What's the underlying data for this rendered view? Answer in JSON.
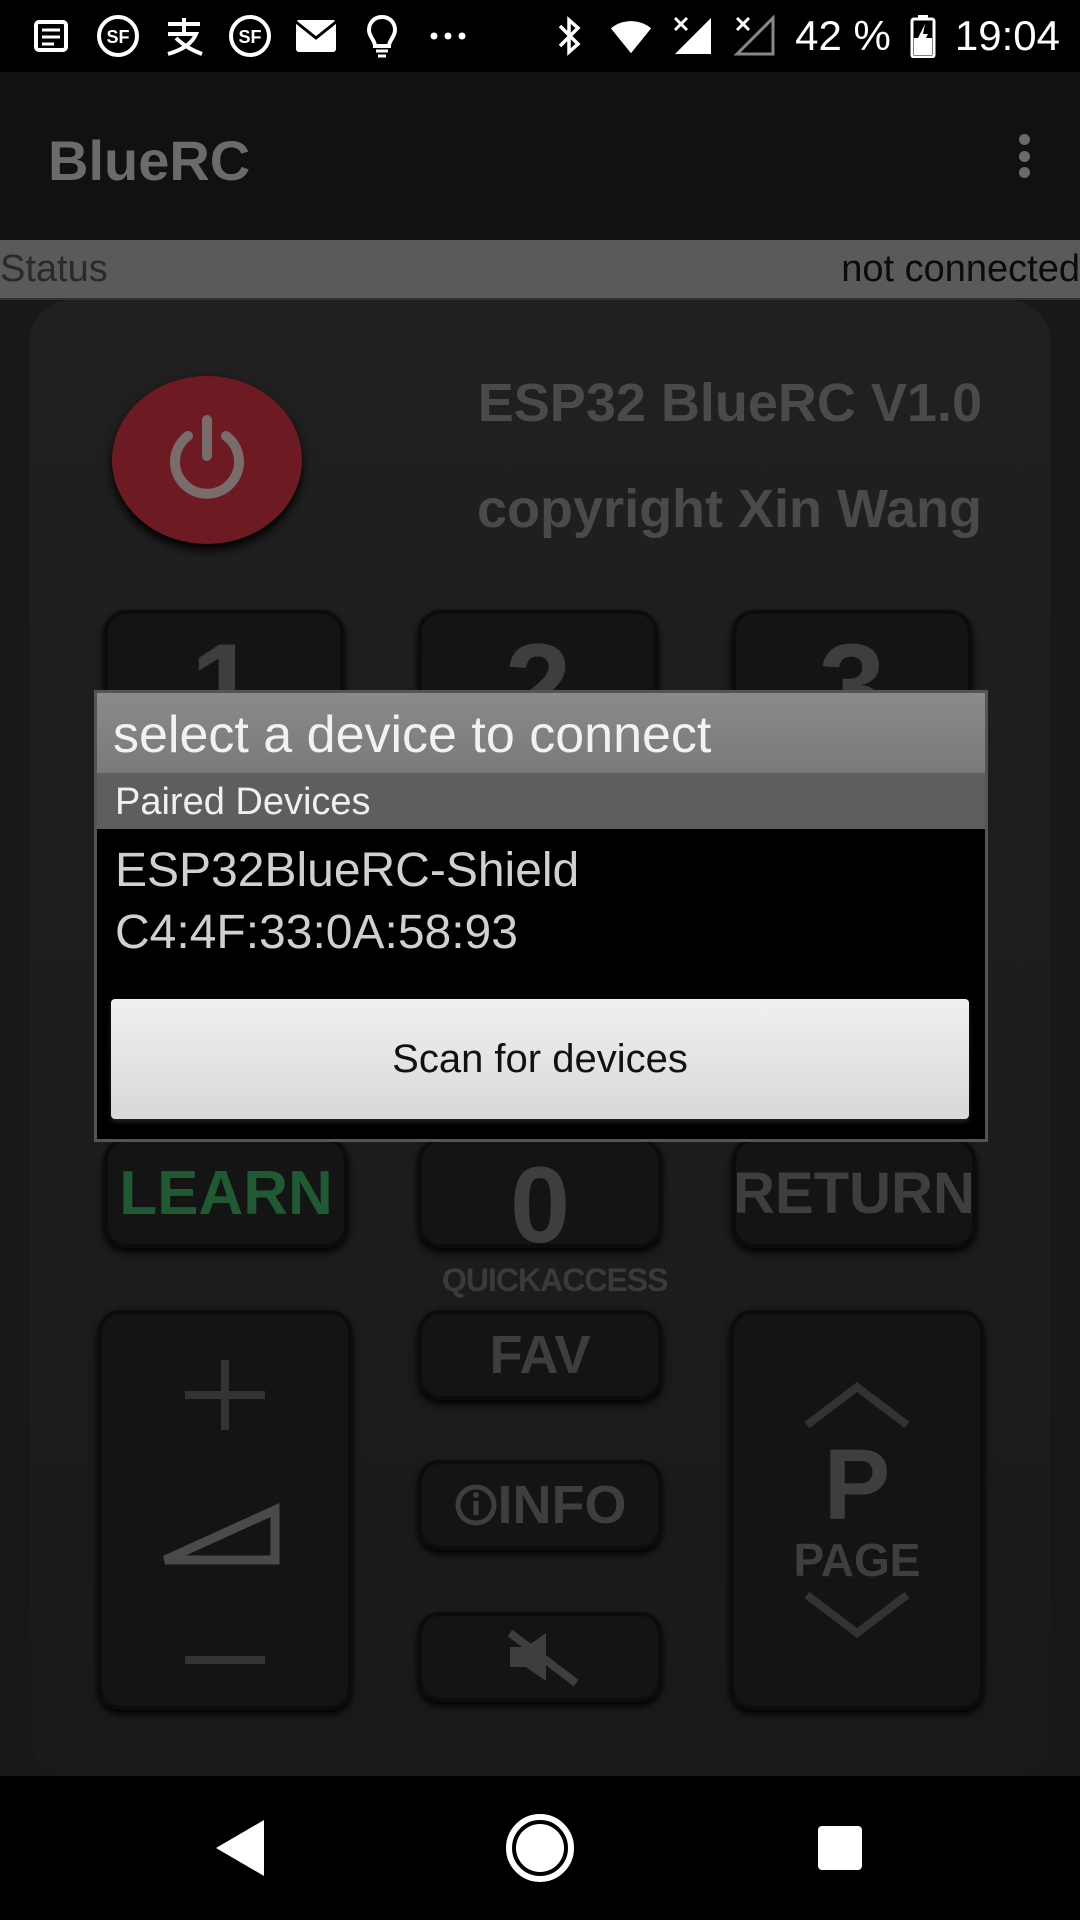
{
  "status_bar": {
    "battery_percent": "42 %",
    "time": "19:04",
    "left_icons": [
      "news-icon",
      "sf-icon",
      "alipay-icon",
      "sf-icon",
      "mail-icon",
      "lightbulb-icon",
      "more-notifications-icon"
    ],
    "right_icons": [
      "bluetooth-icon",
      "wifi-icon",
      "cell-signal-icon",
      "cell-signal-off-icon",
      "battery-icon"
    ]
  },
  "app_bar": {
    "title": "BlueRC",
    "overflow_icon": "more-vert-icon"
  },
  "status_row": {
    "label": "Status",
    "value": "not connected"
  },
  "remote": {
    "title_line1": "ESP32 BlueRC V1.0",
    "title_line2": "copyright Xin Wang",
    "keys": {
      "k1": "1",
      "k2": "2",
      "k3": "3",
      "k0": "0",
      "learn": "LEARN",
      "return": "RETURN",
      "quickaccess": "QUICKACCESS",
      "fav": "FAV",
      "info": "INFO",
      "page_p": "P",
      "page": "PAGE"
    }
  },
  "dialog": {
    "title": "select a device to connect",
    "section": "Paired Devices",
    "devices": [
      {
        "name": "ESP32BlueRC-Shield",
        "address": "C4:4F:33:0A:58:93"
      }
    ],
    "scan_button": "Scan for devices"
  },
  "nav_bar": {
    "buttons": [
      "back-icon",
      "home-icon",
      "recents-icon"
    ]
  },
  "colors": {
    "learn_key": "#1f5a32",
    "power_button": "#6e1a22",
    "dialog_title_bg": "#8a8a8a",
    "dialog_section_bg": "#5e5e5e"
  }
}
